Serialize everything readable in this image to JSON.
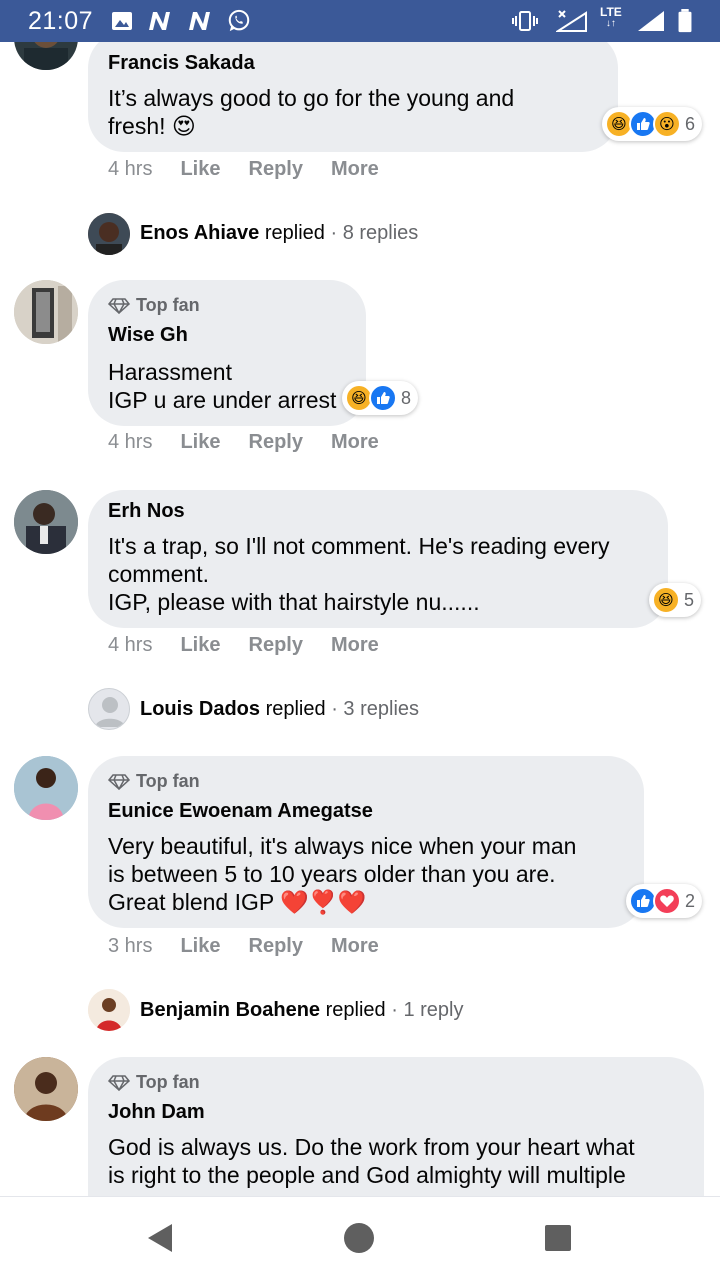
{
  "status_bar": {
    "time": "21:07",
    "network": "LTE",
    "icons": [
      "image-icon",
      "n-icon",
      "n-icon",
      "whatsapp-icon",
      "vibrate-icon",
      "signal-x-icon",
      "lte-icon",
      "signal-icon",
      "battery-icon"
    ]
  },
  "comments": [
    {
      "name": "Francis Sakada",
      "text": "It’s always good to go for the young and\nfresh! 😍",
      "time": "4 hrs",
      "reactions": [
        "laugh",
        "like",
        "wow"
      ],
      "reaction_count": "6"
    },
    {
      "top_fan": "Top fan",
      "name": "Wise Gh",
      "text": "Harassment\nIGP u are under arrest",
      "time": "4 hrs",
      "reactions": [
        "laugh",
        "like"
      ],
      "reaction_count": "8"
    },
    {
      "name": "Erh Nos",
      "text": "It's a trap, so I'll not comment. He's reading every\ncomment.\nIGP, please with that hairstyle nu......",
      "time": "4 hrs",
      "reactions": [
        "laugh"
      ],
      "reaction_count": "5"
    },
    {
      "top_fan": "Top fan",
      "name": "Eunice Ewoenam Amegatse",
      "text": "Very beautiful, it's always nice when your man\nis between 5 to 10 years older than you are.\nGreat blend IGP ❤️❣️❤️",
      "time": "3 hrs",
      "reactions": [
        "like",
        "love"
      ],
      "reaction_count": "2"
    },
    {
      "top_fan": "Top fan",
      "name": "John Dam",
      "text": "God is always us. Do the work from your heart what\nis right to the people and God almighty will multiple"
    }
  ],
  "actions": {
    "like": "Like",
    "reply": "Reply",
    "more": "More"
  },
  "reply_threads": [
    {
      "name": "Enos Ahiave",
      "verb": "replied",
      "sep": "·",
      "count": "8 replies"
    },
    {
      "name": "Louis Dados",
      "verb": "replied",
      "sep": "·",
      "count": "3 replies"
    },
    {
      "name": "Benjamin Boahene",
      "verb": "replied",
      "sep": "·",
      "count": "1 reply"
    }
  ],
  "colors": {
    "status_bar": "#3b5998",
    "bubble": "#ebedf0",
    "muted_text": "#8a8d91",
    "like_blue": "#1877f2",
    "love_red": "#f33e58",
    "laugh_yellow": "#f7b125"
  }
}
